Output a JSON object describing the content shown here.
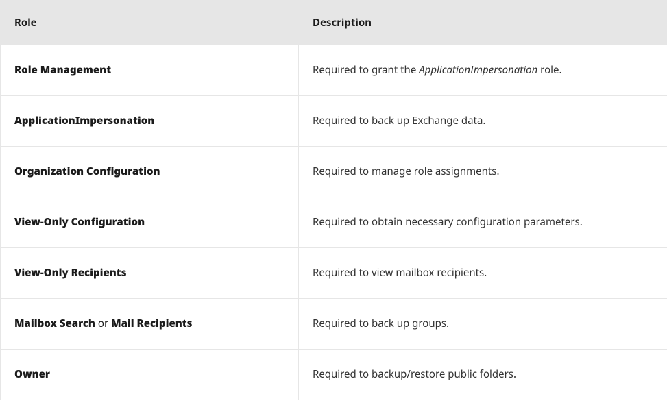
{
  "table": {
    "headers": {
      "role": "Role",
      "description": "Description"
    },
    "rows": [
      {
        "role_html": "<strong>Role Management</strong>",
        "description_html": "Required to grant the <em class=\"italic-term\">ApplicationImpersonation</em> role."
      },
      {
        "role_html": "<strong>ApplicationImpersonation</strong>",
        "description_html": "Required to back up Exchange data."
      },
      {
        "role_html": "<strong>Organization Configuration</strong>",
        "description_html": "Required to manage role assignments."
      },
      {
        "role_html": "<strong>View-Only Configuration</strong>",
        "description_html": "Required to obtain necessary configuration parameters."
      },
      {
        "role_html": "<strong>View-Only Recipients</strong>",
        "description_html": "Required to view mailbox recipients."
      },
      {
        "role_html": "<strong>Mailbox Search</strong> <span class=\"non-bold\">or</span> <strong>Mail Recipients</strong>",
        "description_html": "Required to back up groups."
      },
      {
        "role_html": "<strong>Owner</strong>",
        "description_html": "Required to backup/restore public folders."
      }
    ]
  }
}
